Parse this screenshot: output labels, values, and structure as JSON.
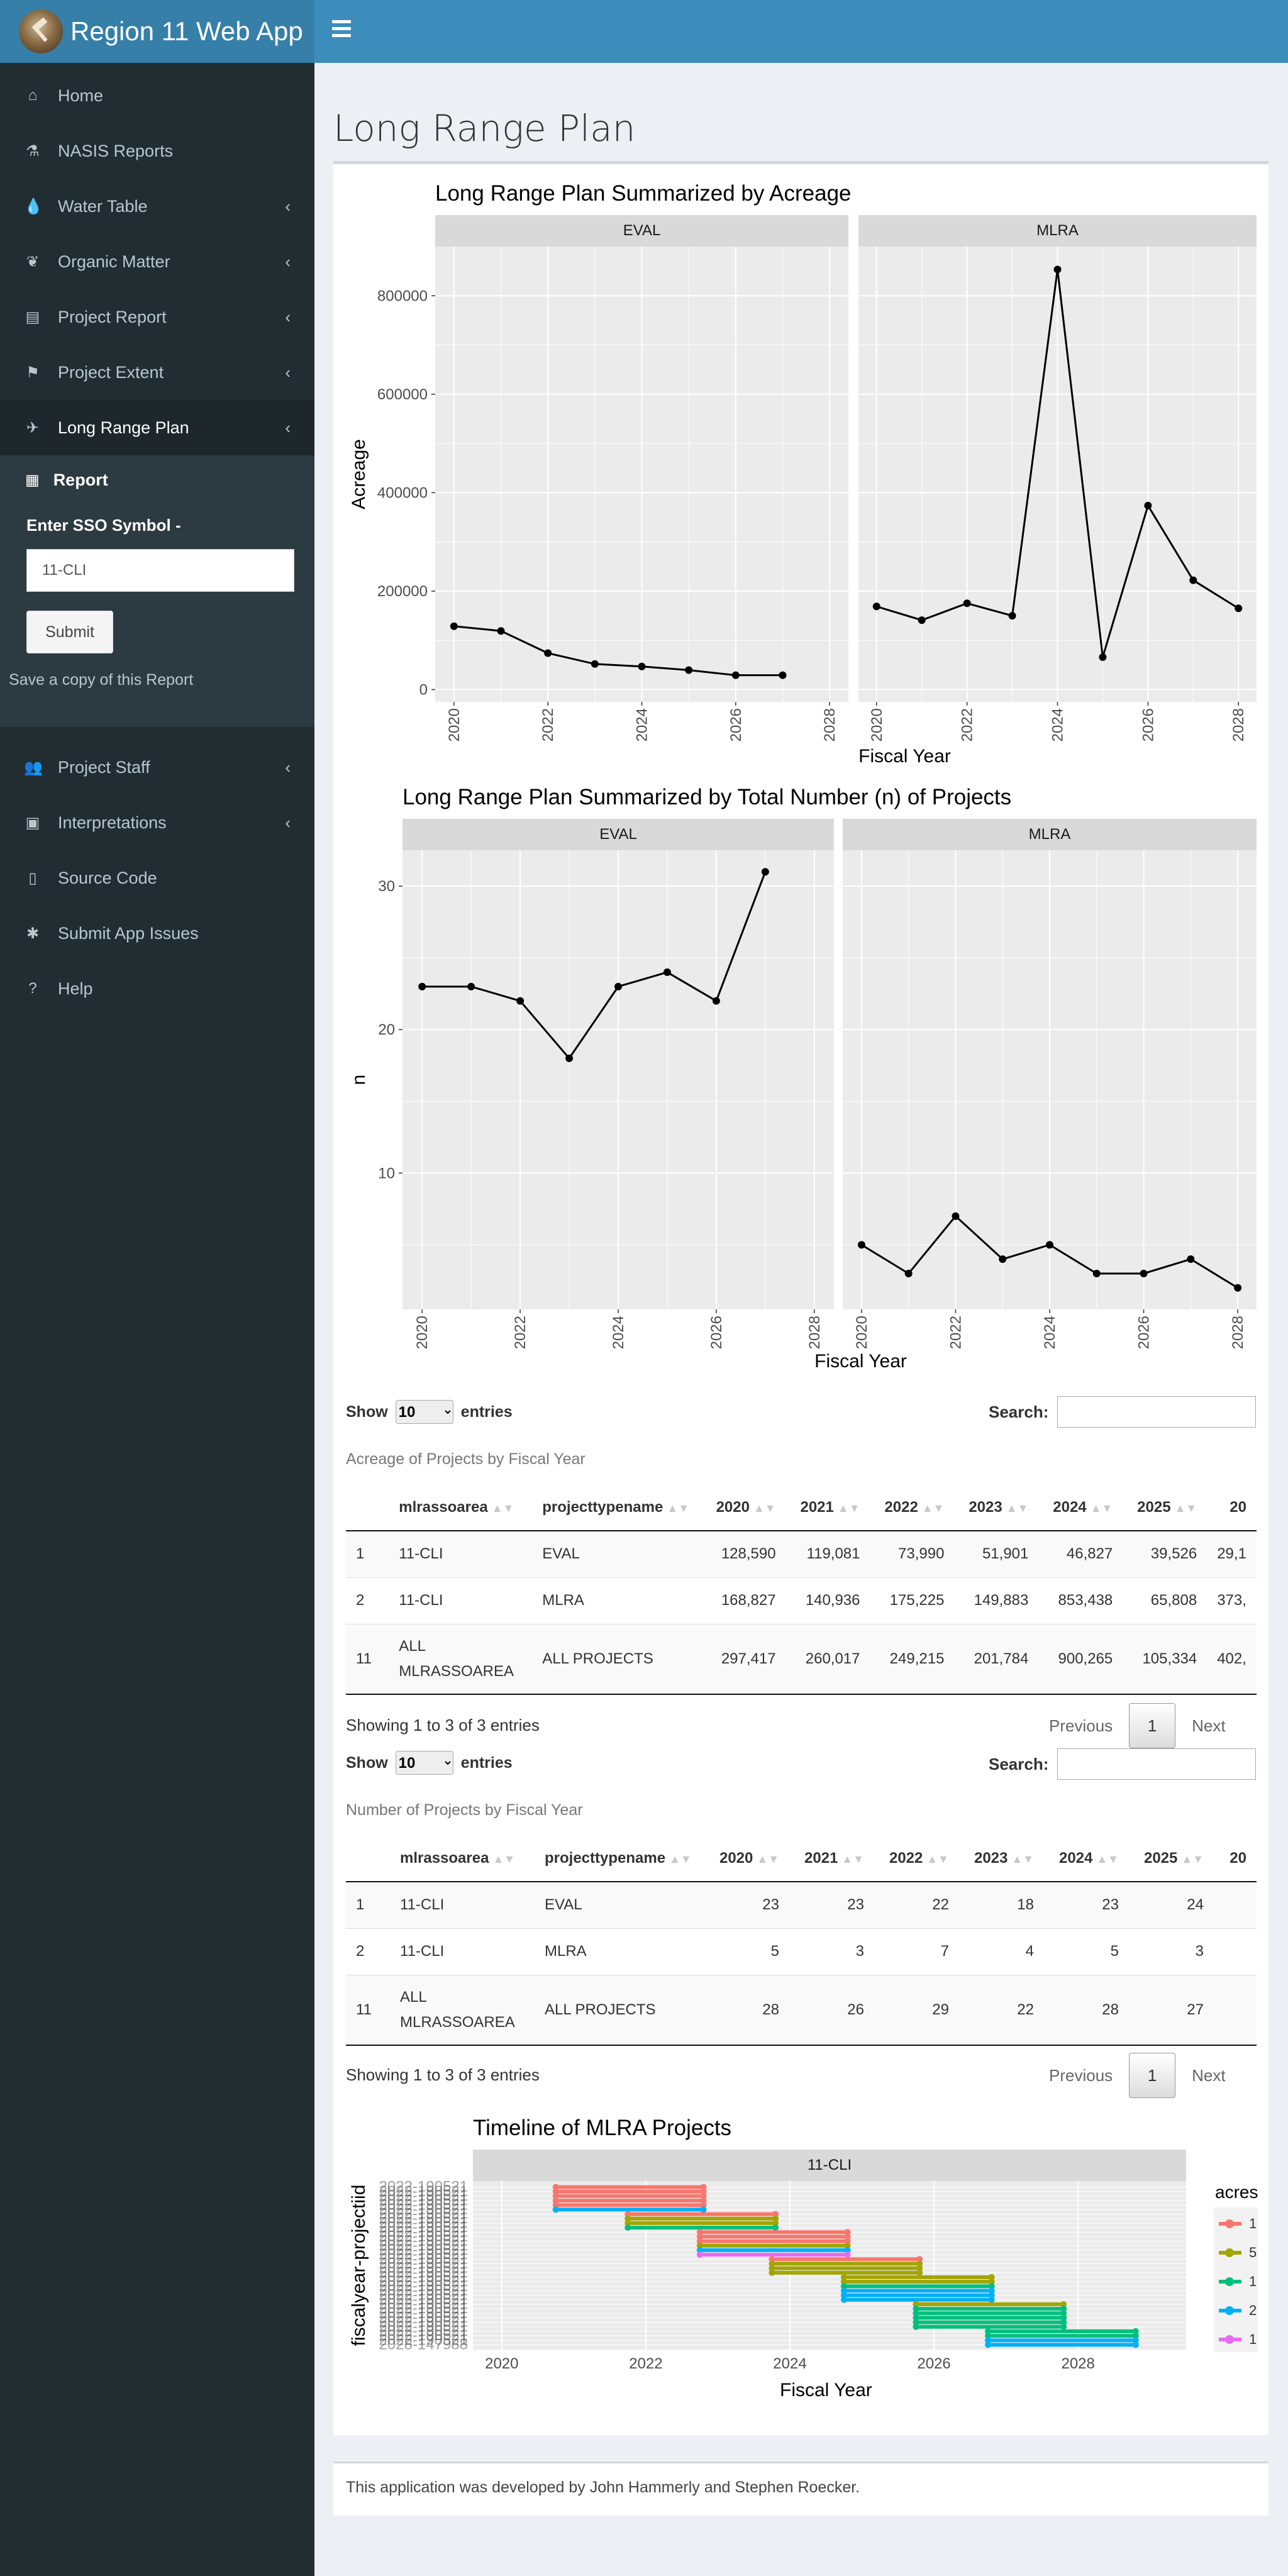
{
  "header": {
    "app_title": "Region 11 Web App"
  },
  "sidebar": {
    "items": [
      {
        "label": "Home",
        "icon": "home-icon"
      },
      {
        "label": "NASIS Reports",
        "icon": "flask-icon"
      },
      {
        "label": "Water Table",
        "icon": "tint-icon"
      },
      {
        "label": "Organic Matter",
        "icon": "leaf-icon"
      },
      {
        "label": "Project Report",
        "icon": "chart-icon"
      },
      {
        "label": "Project Extent",
        "icon": "signs-icon"
      },
      {
        "label": "Long Range Plan",
        "icon": "plane-icon"
      },
      {
        "label": "Project Staff",
        "icon": "users-icon"
      },
      {
        "label": "Interpretations",
        "icon": "archive-icon"
      },
      {
        "label": "Source Code",
        "icon": "code-file-icon"
      },
      {
        "label": "Submit App Issues",
        "icon": "bug-icon"
      },
      {
        "label": "Help",
        "icon": "question-icon"
      }
    ],
    "report_label": "Report",
    "sso_label": "Enter SSO Symbol -",
    "sso_value": "11-CLI",
    "submit_label": "Submit",
    "save_copy": "Save a copy of this Report"
  },
  "page": {
    "title": "Long Range Plan"
  },
  "charts": {
    "acreage": {
      "title": "Long Range Plan Summarized by Acreage",
      "ylabel": "Acreage",
      "xlabel": "Fiscal Year",
      "yticks": [
        "0",
        "200000",
        "400000",
        "600000",
        "800000"
      ],
      "xticks": [
        "2020",
        "2022",
        "2024",
        "2026",
        "2028"
      ],
      "panels": [
        "EVAL",
        "MLRA"
      ]
    },
    "count": {
      "title": "Long Range Plan Summarized by Total Number (n) of Projects",
      "ylabel": "n",
      "xlabel": "Fiscal Year",
      "yticks": [
        "10",
        "20",
        "30"
      ],
      "xticks": [
        "2020",
        "2022",
        "2024",
        "2026",
        "2028"
      ],
      "panels": [
        "EVAL",
        "MLRA"
      ]
    },
    "timeline": {
      "title": "Timeline of MLRA Projects",
      "strip": "11-CLI",
      "ylabel": "fiscalyear-projectiid",
      "xlabel": "Fiscal Year",
      "xticks": [
        "2020",
        "2022",
        "2024",
        "2026",
        "2028"
      ],
      "ytick_top": "2022-190521",
      "ytick_bottom": "2028-147988",
      "legend_title": "acres",
      "legend_colors": [
        "#f8766d",
        "#a3a500",
        "#00bf7d",
        "#00b0f6",
        "#e76bf3"
      ],
      "legend_labels": [
        "1",
        "5",
        "1",
        "2",
        "1"
      ]
    }
  },
  "chart_data": [
    {
      "type": "line",
      "title": "Long Range Plan Summarized by Acreage",
      "xlabel": "Fiscal Year",
      "ylabel": "Acreage",
      "xlim": [
        2019.6,
        2028.4
      ],
      "ylim": [
        -25000,
        900000
      ],
      "series": [
        {
          "name": "EVAL",
          "x": [
            2020,
            2021,
            2022,
            2023,
            2024,
            2025,
            2026,
            2027
          ],
          "values": [
            128590,
            119081,
            73990,
            51901,
            46827,
            39526,
            29100,
            29100
          ]
        },
        {
          "name": "MLRA",
          "x": [
            2020,
            2021,
            2022,
            2023,
            2024,
            2025,
            2026,
            2027,
            2028
          ],
          "values": [
            168827,
            140936,
            175225,
            149883,
            853438,
            65808,
            373800,
            222000,
            165000
          ]
        }
      ]
    },
    {
      "type": "line",
      "title": "Long Range Plan Summarized by Total Number (n) of Projects",
      "xlabel": "Fiscal Year",
      "ylabel": "n",
      "xlim": [
        2019.6,
        2028.4
      ],
      "ylim": [
        0.5,
        32.5
      ],
      "series": [
        {
          "name": "EVAL",
          "x": [
            2020,
            2021,
            2022,
            2023,
            2024,
            2025,
            2026,
            2027
          ],
          "values": [
            23,
            23,
            22,
            18,
            23,
            24,
            22,
            31
          ]
        },
        {
          "name": "MLRA",
          "x": [
            2020,
            2021,
            2022,
            2023,
            2024,
            2025,
            2026,
            2027,
            2028
          ],
          "values": [
            5,
            3,
            7,
            4,
            5,
            3,
            3,
            4,
            2
          ]
        }
      ]
    },
    {
      "type": "bar",
      "title": "Timeline of MLRA Projects",
      "xlabel": "Fiscal Year",
      "ylabel": "fiscalyear-projectiid",
      "xlim": [
        2019.6,
        2029.5
      ],
      "rows": 36,
      "groups": [
        {
          "start": 2020.75,
          "end": 2022.8,
          "rows": [
            0,
            1,
            2,
            3,
            4,
            5
          ],
          "colors": [
            0,
            0,
            0,
            0,
            0,
            3
          ]
        },
        {
          "start": 2021.75,
          "end": 2023.8,
          "rows": [
            6,
            7,
            8,
            9
          ],
          "colors": [
            0,
            1,
            1,
            2
          ]
        },
        {
          "start": 2022.75,
          "end": 2024.8,
          "rows": [
            10,
            11,
            12,
            13,
            14,
            15
          ],
          "colors": [
            0,
            0,
            0,
            1,
            3,
            4
          ]
        },
        {
          "start": 2023.75,
          "end": 2025.8,
          "rows": [
            16,
            17,
            18,
            19
          ],
          "colors": [
            0,
            1,
            1,
            1
          ]
        },
        {
          "start": 2024.75,
          "end": 2026.8,
          "rows": [
            20,
            21,
            22,
            23,
            24,
            25
          ],
          "colors": [
            1,
            1,
            2,
            3,
            3,
            3
          ]
        },
        {
          "start": 2025.75,
          "end": 2027.8,
          "rows": [
            26,
            27,
            28,
            29,
            30,
            31
          ],
          "colors": [
            1,
            2,
            2,
            2,
            2,
            2
          ]
        },
        {
          "start": 2026.75,
          "end": 2028.8,
          "rows": [
            32,
            33,
            34,
            35
          ],
          "colors": [
            2,
            2,
            3,
            3
          ]
        }
      ]
    }
  ],
  "tables": [
    {
      "show_label": "Show",
      "entries_label": "entries",
      "length_value": "10",
      "search_label": "Search:",
      "caption": "Acreage of Projects by Fiscal Year",
      "headers": [
        "",
        "mlrassoarea",
        "projecttypename",
        "2020",
        "2021",
        "2022",
        "2023",
        "2024",
        "2025",
        "20"
      ],
      "rows": [
        [
          "1",
          "11-CLI",
          "EVAL",
          "128,590",
          "119,081",
          "73,990",
          "51,901",
          "46,827",
          "39,526",
          "29,1"
        ],
        [
          "2",
          "11-CLI",
          "MLRA",
          "168,827",
          "140,936",
          "175,225",
          "149,883",
          "853,438",
          "65,808",
          "373,"
        ],
        [
          "11",
          "ALL MLRASSOAREA",
          "ALL PROJECTS",
          "297,417",
          "260,017",
          "249,215",
          "201,784",
          "900,265",
          "105,334",
          "402,"
        ]
      ],
      "info": "Showing 1 to 3 of 3 entries",
      "prev": "Previous",
      "page": "1",
      "next": "Next"
    },
    {
      "show_label": "Show",
      "entries_label": "entries",
      "length_value": "10",
      "search_label": "Search:",
      "caption": "Number of Projects by Fiscal Year",
      "headers": [
        "",
        "mlrassoarea",
        "projecttypename",
        "2020",
        "2021",
        "2022",
        "2023",
        "2024",
        "2025",
        "20"
      ],
      "rows": [
        [
          "1",
          "11-CLI",
          "EVAL",
          "23",
          "23",
          "22",
          "18",
          "23",
          "24",
          ""
        ],
        [
          "2",
          "11-CLI",
          "MLRA",
          "5",
          "3",
          "7",
          "4",
          "5",
          "3",
          ""
        ],
        [
          "11",
          "ALL MLRASSOAREA",
          "ALL PROJECTS",
          "28",
          "26",
          "29",
          "22",
          "28",
          "27",
          ""
        ]
      ],
      "info": "Showing 1 to 3 of 3 entries",
      "prev": "Previous",
      "page": "1",
      "next": "Next"
    }
  ],
  "footer": {
    "text": "This application was developed by John Hammerly and Stephen Roecker."
  }
}
